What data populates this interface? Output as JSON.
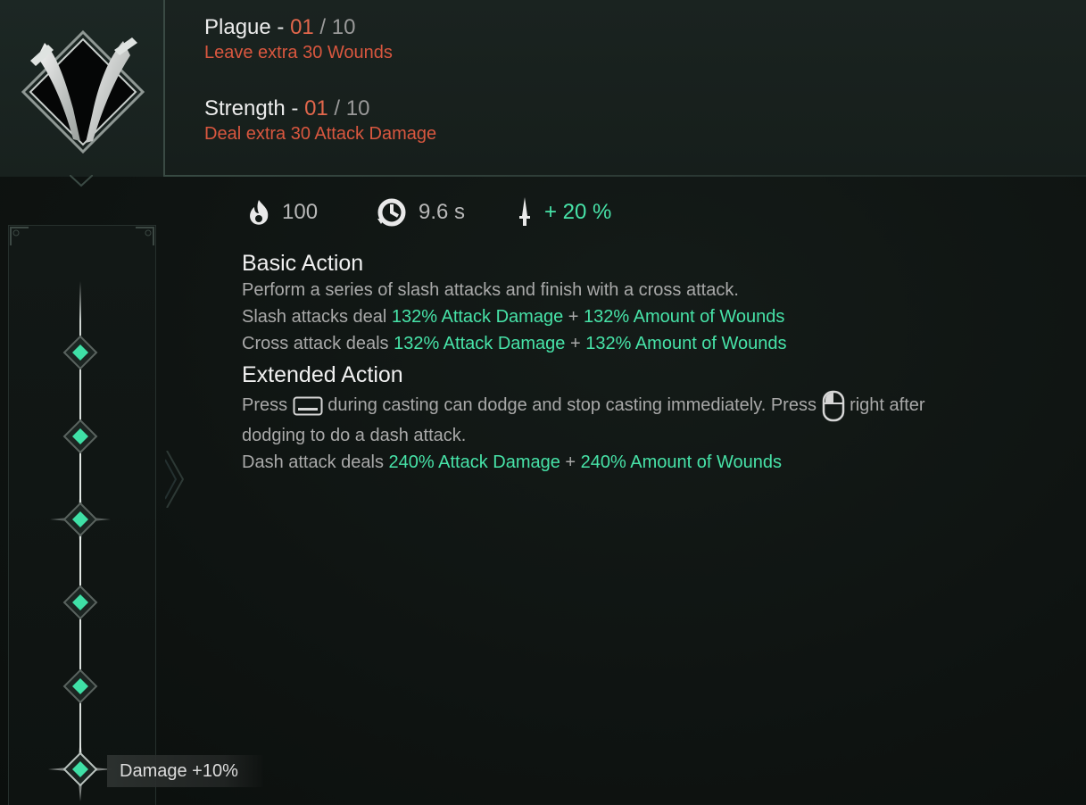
{
  "upgrades": [
    {
      "name": "Plague",
      "dash": " - ",
      "current": "01",
      "sep": " / ",
      "max": "10",
      "description": "Leave extra 30 Wounds"
    },
    {
      "name": "Strength",
      "dash": " - ",
      "current": "01",
      "sep": " / ",
      "max": "10",
      "description": "Deal extra 30 Attack Damage"
    }
  ],
  "stats": {
    "energy": {
      "icon": "flame-icon",
      "value": "100"
    },
    "cooldown": {
      "icon": "cooldown-timer-icon",
      "value": "9.6 s"
    },
    "bonus": {
      "icon": "dagger-icon",
      "value": "+ 20 %"
    }
  },
  "basic_action": {
    "title": "Basic Action",
    "line1": "Perform a series of slash attacks and finish with a cross attack.",
    "line2_prefix": "Slash attacks deal ",
    "line2_a": "132% Attack Damage",
    "line2_plus": " + ",
    "line2_b": "132% Amount of Wounds",
    "line3_prefix": "Cross attack deals ",
    "line3_a": "132% Attack Damage",
    "line3_plus": " + ",
    "line3_b": "132% Amount of Wounds"
  },
  "extended_action": {
    "title": "Extended Action",
    "line1_a": "Press ",
    "line1_key_icon": "spacebar-key-icon",
    "line1_b": " during casting can dodge and stop casting immediately. Press ",
    "line1_mouse_icon": "mouse-right-click-icon",
    "line1_c": " right after",
    "line2": "dodging to do a dash attack.",
    "line3_prefix": "Dash attack deals ",
    "line3_a": "240% Attack Damage",
    "line3_plus": " + ",
    "line3_b": "240% Amount of Wounds"
  },
  "skill_tree": {
    "node_count": 6,
    "selected_bonus": "Damage +10%"
  },
  "colors": {
    "accent_green": "#47e3a8",
    "accent_red": "#e2674c",
    "background": "#0f1412"
  }
}
